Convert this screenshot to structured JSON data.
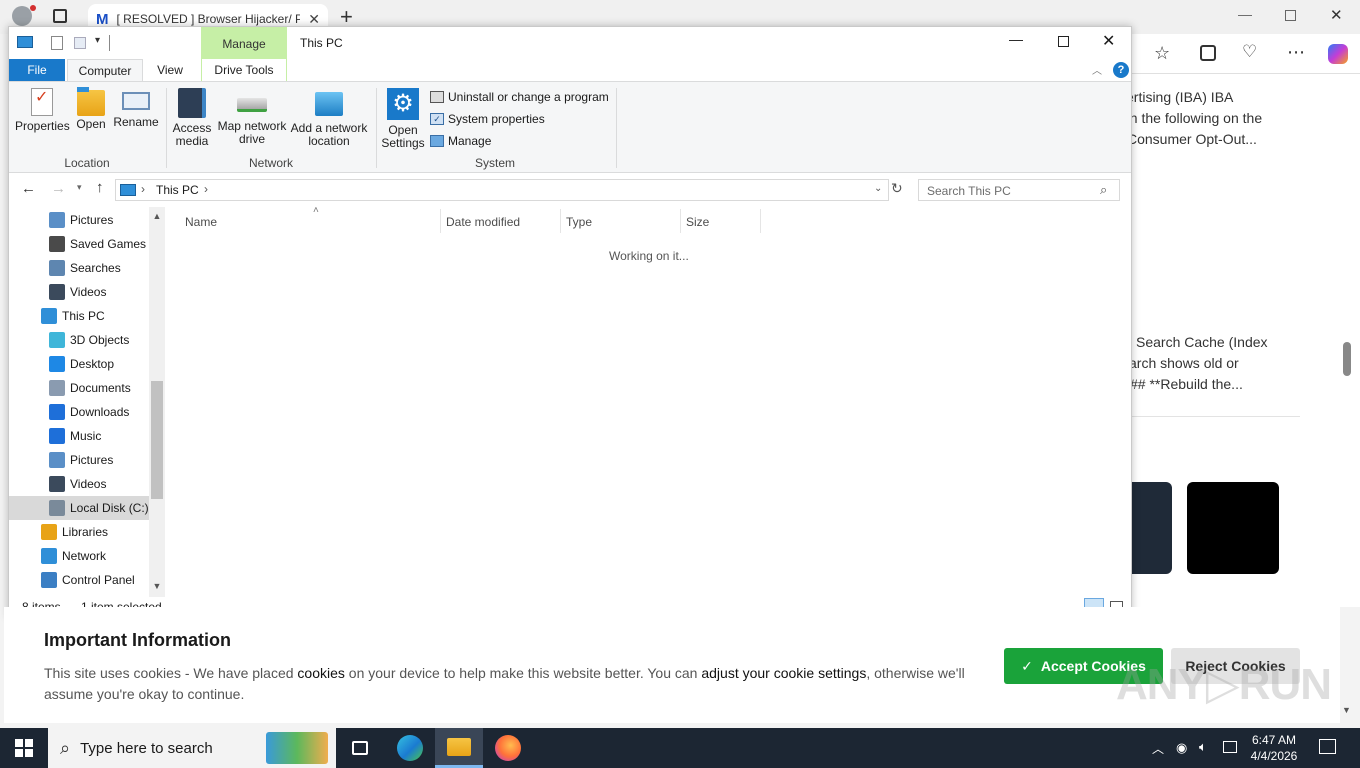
{
  "browser": {
    "tab_title": "[ RESOLVED ] Browser Hijacker/ Po",
    "web_snippet_1": [
      "ertising (IBA) IBA",
      "gh the following on the",
      "Consumer Opt-Out..."
    ],
    "web_snippet_2": [
      "Search Cache (Index",
      "arch shows old or",
      "## **Rebuild the..."
    ]
  },
  "explorer": {
    "window_title": "This PC",
    "context_tab": "Manage",
    "tabs": [
      "File",
      "Computer",
      "View",
      "Drive Tools"
    ],
    "ribbon": {
      "location": {
        "label": "Location",
        "buttons": [
          "Properties",
          "Open",
          "Rename"
        ]
      },
      "network": {
        "label": "Network",
        "access_media": "Access\nmedia",
        "map_drive": "Map network\ndrive",
        "add_location": "Add a network\nlocation"
      },
      "system": {
        "label": "System",
        "open_settings": "Open\nSettings",
        "uninstall": "Uninstall or change a program",
        "sys_props": "System properties",
        "manage": "Manage"
      }
    },
    "address": {
      "crumb": "This PC",
      "search_placeholder": "Search This PC"
    },
    "nav": [
      {
        "label": "Pictures",
        "icon": "pictures-icon",
        "indent": 1
      },
      {
        "label": "Saved Games",
        "icon": "saved-games-icon",
        "indent": 1
      },
      {
        "label": "Searches",
        "icon": "search-icon",
        "indent": 1
      },
      {
        "label": "Videos",
        "icon": "videos-icon",
        "indent": 1
      },
      {
        "label": "This PC",
        "icon": "computer-icon",
        "indent": 0
      },
      {
        "label": "3D Objects",
        "icon": "3d-objects-icon",
        "indent": 1
      },
      {
        "label": "Desktop",
        "icon": "desktop-icon",
        "indent": 1
      },
      {
        "label": "Documents",
        "icon": "documents-icon",
        "indent": 1
      },
      {
        "label": "Downloads",
        "icon": "downloads-icon",
        "indent": 1
      },
      {
        "label": "Music",
        "icon": "music-icon",
        "indent": 1
      },
      {
        "label": "Pictures",
        "icon": "pictures-icon",
        "indent": 1
      },
      {
        "label": "Videos",
        "icon": "videos-icon",
        "indent": 1
      },
      {
        "label": "Local Disk (C:)",
        "icon": "drive-icon",
        "indent": 1,
        "selected": true
      },
      {
        "label": "Libraries",
        "icon": "libraries-icon",
        "indent": 0
      },
      {
        "label": "Network",
        "icon": "network-icon",
        "indent": 0
      },
      {
        "label": "Control Panel",
        "icon": "control-panel-icon",
        "indent": 0
      }
    ],
    "columns": [
      "Name",
      "Date modified",
      "Type",
      "Size"
    ],
    "loading_text": "Working on it...",
    "status": {
      "items": "8 items",
      "selected": "1 item selected"
    }
  },
  "cookie": {
    "heading": "Important Information",
    "text_1": "This site uses cookies - We have placed ",
    "link_1": "cookies",
    "text_2": " on your device to help make this website better. You can ",
    "link_2": "adjust your cookie settings",
    "text_3": ", otherwise we'll",
    "text_4": "assume you're okay to continue.",
    "accept": "Accept Cookies",
    "reject": "Reject Cookies"
  },
  "taskbar": {
    "search_placeholder": "Type here to search",
    "time": "6:47 AM",
    "date": "4/4/2026"
  },
  "colors": {
    "accent": "#1979ca",
    "manage_tab": "#c6efa6",
    "accept_green": "#1aa33a",
    "taskbar": "#1c2633"
  }
}
